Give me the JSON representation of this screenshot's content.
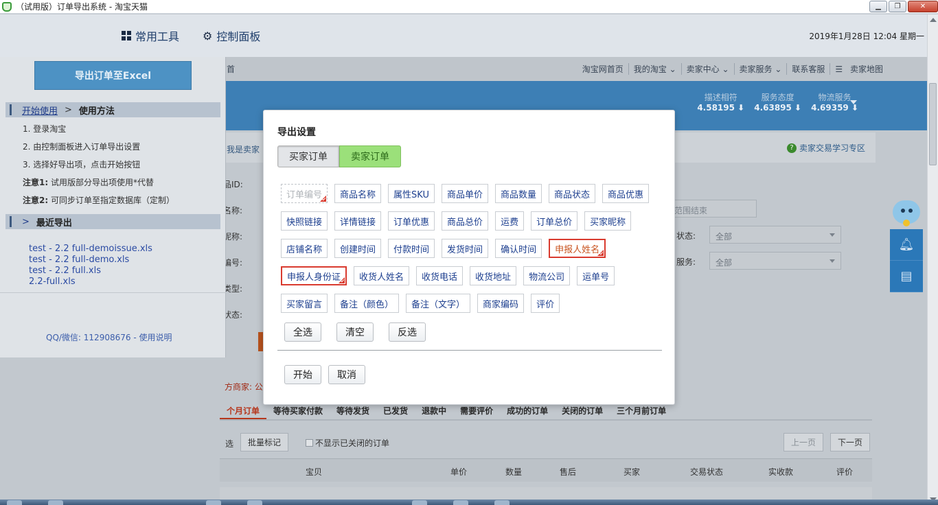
{
  "window": {
    "title": "（试用版）订单导出系统 - 淘宝天猫",
    "controls": [
      "minimize",
      "maximize",
      "close"
    ]
  },
  "app_toolbar": {
    "common_tools": "常用工具",
    "control_panel": "控制面板",
    "datetime": "2019年1月28日 12:04 星期一"
  },
  "side_panel": {
    "export_button": "导出订单至Excel",
    "start_link": "开始使用",
    "start_sep": ">",
    "usage_title": "使用方法",
    "steps": [
      "1. 登录淘宝",
      "2. 由控制面板进入订单导出设置",
      "3. 选择好导出项，点击开始按钮"
    ],
    "note1_label": "注意1:",
    "note1_text": "试用版部分导出项使用*代替",
    "note2_label": "注意2:",
    "note2_text": "可同步订单至指定数据库（定制）",
    "recent_marker": ">",
    "recent_title": "最近导出",
    "recent_files": [
      "test - 2.2 full-demoissue.xls",
      "test - 2.2 full-demo.xls",
      "test - 2.2 full.xls",
      "2.2-full.xls"
    ],
    "contact": "QQ/微信: 112908676 - 使用说明"
  },
  "background_page": {
    "nav_left_fragment": "首",
    "nav_links": [
      "淘宝网首页",
      "我的淘宝 ⌄",
      "卖家中心 ⌄",
      "卖家服务 ⌄",
      "联系客服",
      "卖家地图"
    ],
    "ratings": [
      {
        "label": "描述相符",
        "value": "4.58195 ⬇"
      },
      {
        "label": "服务态度",
        "value": "4.63895 ⬇"
      },
      {
        "label": "物流服务",
        "value": "4.69359 ⬇"
      }
    ],
    "seller_fragment": "我是卖家",
    "help_link": "卖家交易学习专区",
    "form_labels": [
      "品ID:",
      "名称:",
      "昵称:",
      "编号:",
      "类型:",
      "状态:"
    ],
    "range_end_placeholder": "范围结束",
    "status_label_fragment": "状态:",
    "status_select": "全部",
    "service_label_fragment": "服务:",
    "service_select": "全部",
    "red_text": "方商家: 公",
    "tabs": [
      "个月订单",
      "等待买家付款",
      "等待发货",
      "已发货",
      "退款中",
      "需要评价",
      "成功的订单",
      "关闭的订单",
      "三个月前订单"
    ],
    "select_fragment": "选",
    "batch_mark": "批量标记",
    "hide_closed": "不显示已关闭的订单",
    "prev_page": "上一页",
    "next_page": "下一页",
    "table_headers": [
      "宝贝",
      "单价",
      "数量",
      "售后",
      "买家",
      "交易状态",
      "实收款",
      "评价"
    ]
  },
  "modal": {
    "title": "导出设置",
    "tabs": [
      {
        "label": "买家订单",
        "active": false
      },
      {
        "label": "卖家订单",
        "active": true
      }
    ],
    "field_rows": [
      [
        {
          "label": "订单编号",
          "state": "dashed-selected"
        },
        {
          "label": "商品名称"
        },
        {
          "label": "属性SKU"
        },
        {
          "label": "商品单价"
        },
        {
          "label": "商品数量"
        },
        {
          "label": "商品状态"
        },
        {
          "label": "商品优惠"
        }
      ],
      [
        {
          "label": "快照链接"
        },
        {
          "label": "详情链接"
        },
        {
          "label": "订单优惠"
        },
        {
          "label": "商品总价"
        },
        {
          "label": "运费"
        },
        {
          "label": "订单总价"
        },
        {
          "label": "买家昵称"
        }
      ],
      [
        {
          "label": "店铺名称"
        },
        {
          "label": "创建时间"
        },
        {
          "label": "付款时间"
        },
        {
          "label": "发货时间"
        },
        {
          "label": "确认时间"
        },
        {
          "label": "申报人姓名",
          "state": "selected-orange"
        }
      ],
      [
        {
          "label": "申报人身份证",
          "state": "selected"
        },
        {
          "label": "收货人姓名"
        },
        {
          "label": "收货电话"
        },
        {
          "label": "收货地址"
        },
        {
          "label": "物流公司"
        },
        {
          "label": "运单号"
        }
      ],
      [
        {
          "label": "买家留言"
        },
        {
          "label": "备注（颜色）"
        },
        {
          "label": "备注（文字）"
        },
        {
          "label": "商家编码"
        },
        {
          "label": "评价"
        }
      ]
    ],
    "select_all": "全选",
    "clear": "清空",
    "invert": "反选",
    "start": "开始",
    "cancel": "取消"
  },
  "colors": {
    "active_tab": "#9be07a",
    "selected_border": "#d93a2e",
    "field_text": "#1d3f8f",
    "orange_text": "#c9531f"
  }
}
